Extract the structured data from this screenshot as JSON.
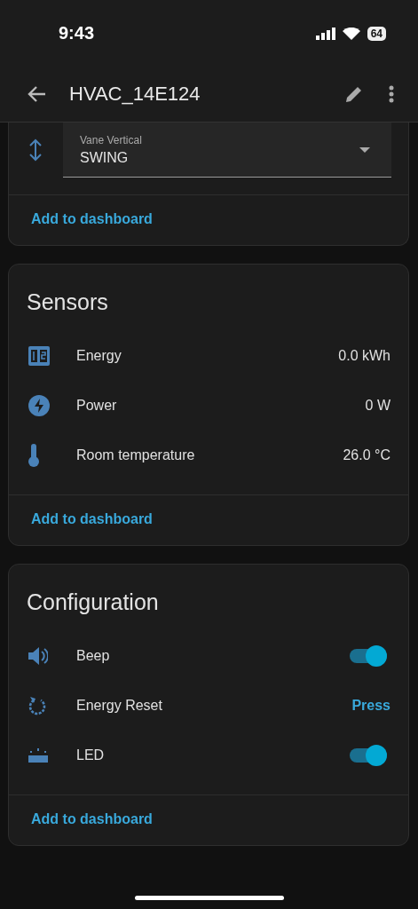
{
  "status_bar": {
    "time": "9:43",
    "battery": "64"
  },
  "header": {
    "title": "HVAC_14E124"
  },
  "cards": [
    {
      "select": {
        "label": "Vane Vertical",
        "value": "SWING"
      },
      "footer": "Add to dashboard"
    },
    {
      "title": "Sensors",
      "rows": [
        {
          "kind": "sensor",
          "name": "Energy",
          "value": "0.0 kWh"
        },
        {
          "kind": "sensor",
          "name": "Power",
          "value": "0 W"
        },
        {
          "kind": "sensor",
          "name": "Room temperature",
          "value": "26.0 °C"
        }
      ],
      "footer": "Add to dashboard"
    },
    {
      "title": "Configuration",
      "rows": [
        {
          "kind": "toggle",
          "name": "Beep",
          "on": true
        },
        {
          "kind": "button",
          "name": "Energy Reset",
          "action": "Press"
        },
        {
          "kind": "toggle",
          "name": "LED",
          "on": true
        }
      ],
      "footer": "Add to dashboard"
    }
  ]
}
